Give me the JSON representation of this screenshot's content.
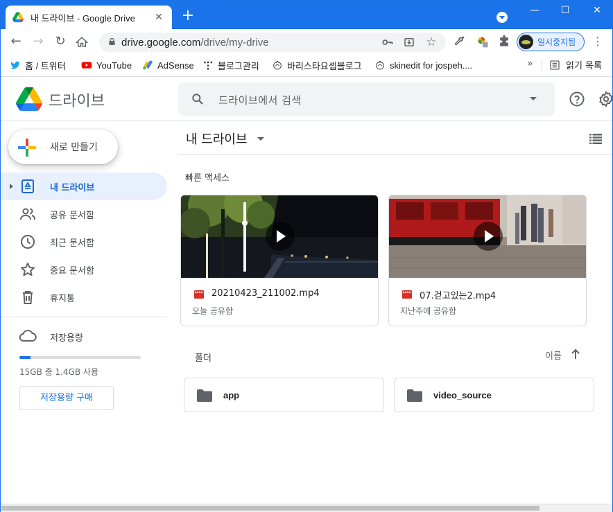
{
  "browser": {
    "tab_title": "내 드라이브 - Google Drive",
    "url_host": "drive.google.com",
    "url_path": "/drive/my-drive",
    "profile_status": "일시중지됨",
    "accent_color": "#1a73e8"
  },
  "bookmarks": {
    "items": [
      {
        "label": "홈 / 트위터",
        "icon": "twitter-icon"
      },
      {
        "label": "YouTube",
        "icon": "youtube-icon"
      },
      {
        "label": "AdSense",
        "icon": "adsense-icon"
      },
      {
        "label": "블로그관리",
        "icon": "blog-icon"
      },
      {
        "label": "바리스타요셉블로그",
        "icon": "barista-icon"
      },
      {
        "label": "skinedit for jospeh....",
        "icon": "skinedit-icon"
      }
    ],
    "more": "»",
    "reading_list": "읽기 목록"
  },
  "drive": {
    "app_name": "드라이브",
    "search_placeholder": "드라이브에서 검색",
    "new_button": "새로 만들기",
    "nav": [
      {
        "label": "내 드라이브",
        "icon": "my-drive-icon",
        "active": true
      },
      {
        "label": "공유 문서함",
        "icon": "shared-icon",
        "active": false
      },
      {
        "label": "최근 문서함",
        "icon": "clock-icon",
        "active": false
      },
      {
        "label": "중요 문서함",
        "icon": "star-icon",
        "active": false
      },
      {
        "label": "휴지통",
        "icon": "trash-icon",
        "active": false
      }
    ],
    "storage": {
      "label": "저장용량",
      "usage_text": "15GB 중 1.4GB 사용",
      "used_fraction": 0.093,
      "buy_label": "저장용량 구매"
    },
    "main_title": "내 드라이브",
    "quick_access_label": "빠른 액세스",
    "quick_access": [
      {
        "name": "20210423_211002.mp4",
        "meta": "오늘 공유함",
        "icon": "video-icon"
      },
      {
        "name": "07.걷고있는2.mp4",
        "meta": "지난주에 공유함",
        "icon": "video-icon"
      }
    ],
    "folders_label": "폴더",
    "sort_label": "이름",
    "folders": [
      {
        "name": "app",
        "icon": "folder-icon"
      },
      {
        "name": "video_source",
        "icon": "folder-icon"
      }
    ]
  }
}
